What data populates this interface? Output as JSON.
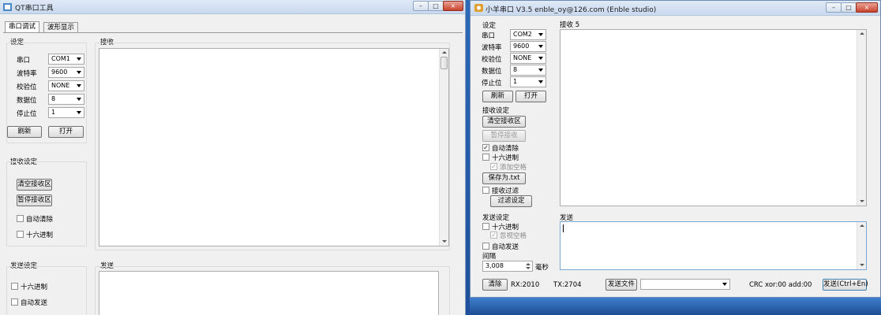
{
  "left_window": {
    "title": "QT串口工具",
    "tabs": [
      "串口调试",
      "波形显示"
    ],
    "settings_group": "设定",
    "fields": [
      {
        "label": "串口",
        "value": "COM1"
      },
      {
        "label": "波特率",
        "value": "9600"
      },
      {
        "label": "校验位",
        "value": "NONE"
      },
      {
        "label": "数据位",
        "value": "8"
      },
      {
        "label": "停止位",
        "value": "1"
      }
    ],
    "refresh_btn": "刷新",
    "open_btn": "打开",
    "receive_settings_group": "接收设定",
    "clear_receive_btn": "清空接收区",
    "pause_receive_btn": "暂停接收区",
    "auto_clear_label": "自动清除",
    "hex_receive_label": "十六进制",
    "send_settings_group": "发送设定",
    "hex_send_label": "十六进制",
    "auto_send_label": "自动发送",
    "receive_group": "接收",
    "send_group": "发送"
  },
  "right_window": {
    "title": "小羊串口 V3.5   enble_oy@126.com (Enble studio)",
    "settings_group": "设定",
    "fields": [
      {
        "label": "串口",
        "value": "COM2"
      },
      {
        "label": "波特率",
        "value": "9600"
      },
      {
        "label": "校验位",
        "value": "NONE"
      },
      {
        "label": "数据位",
        "value": "8"
      },
      {
        "label": "停止位",
        "value": "1"
      }
    ],
    "refresh_btn": "刷新",
    "open_btn": "打开",
    "receive_settings_group": "接收设定",
    "clear_receive_btn": "清空接收区",
    "pause_receive_btn": "暂停接收",
    "auto_clear_label": "自动清除",
    "auto_clear_checked": true,
    "hex_label": "十六进制",
    "add_space_label": "添加空格",
    "save_btn": "保存为.txt",
    "filter_label": "接收过滤",
    "filter_settings_btn": "过滤设定",
    "send_settings_group": "发送设定",
    "hex_send_label": "十六进制",
    "ignore_space_label": "忽视空格",
    "auto_send_label": "自动发送",
    "interval_label": "间隔",
    "interval_value": "3,008",
    "interval_unit": "毫秒",
    "receive_label": "接收 5",
    "send_label": "发送",
    "clear_btn": "清除",
    "rx_text": "RX:2010",
    "tx_text": "TX:2704",
    "send_file_btn": "发送文件",
    "file_select_value": "",
    "crc_text": "CRC xor:00  add:00",
    "send_btn": "发送(Ctrl+En)"
  },
  "window_buttons": {
    "minimize": "–",
    "maximize": "□",
    "close": "×"
  },
  "colors": {
    "desktop": "#2f67b5",
    "window_bg": "#f0f0f0",
    "titlebar": "#dfe9f6"
  }
}
